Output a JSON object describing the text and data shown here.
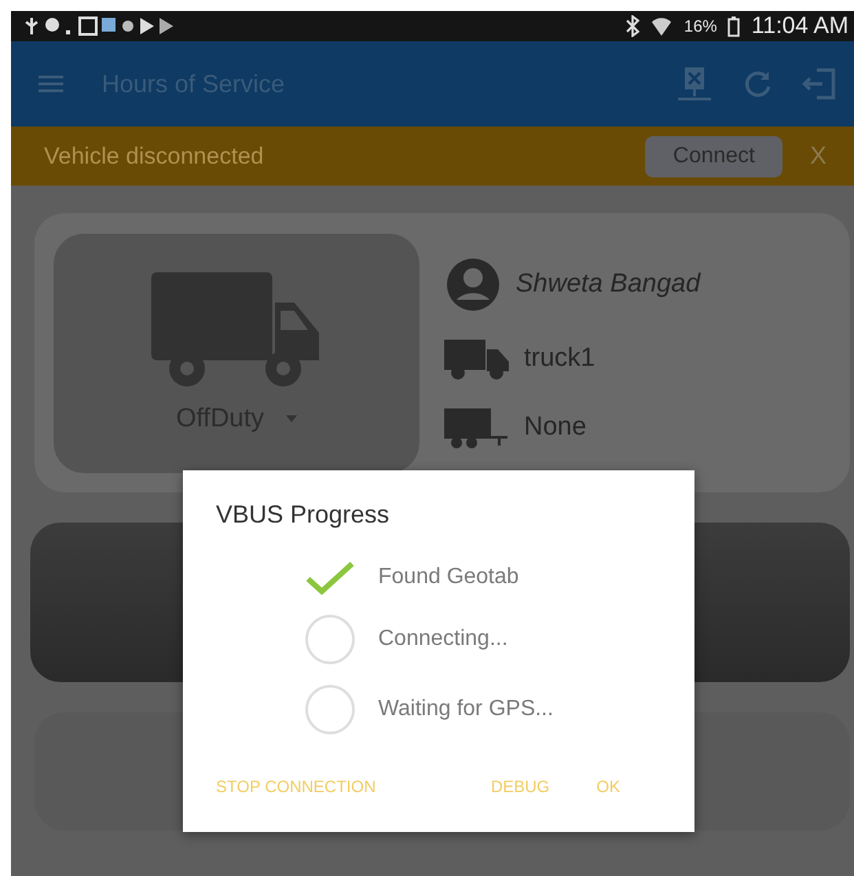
{
  "status_bar": {
    "battery": "16%",
    "time": "11:04 AM"
  },
  "app_bar": {
    "title": "Hours of Service"
  },
  "banner": {
    "message": "Vehicle disconnected",
    "action": "Connect",
    "close": "X"
  },
  "status_tile": {
    "duty_status": "OffDuty"
  },
  "driver": {
    "name": "Shweta Bangad",
    "vehicle": "truck1",
    "trailer": "None"
  },
  "dialog": {
    "title": "VBUS Progress",
    "steps": [
      {
        "label": "Found Geotab",
        "done": true
      },
      {
        "label": "Connecting...",
        "done": false
      },
      {
        "label": "Waiting for GPS...",
        "done": false
      }
    ],
    "buttons": [
      "STOP CONNECTION",
      "DEBUG",
      "OK"
    ]
  }
}
